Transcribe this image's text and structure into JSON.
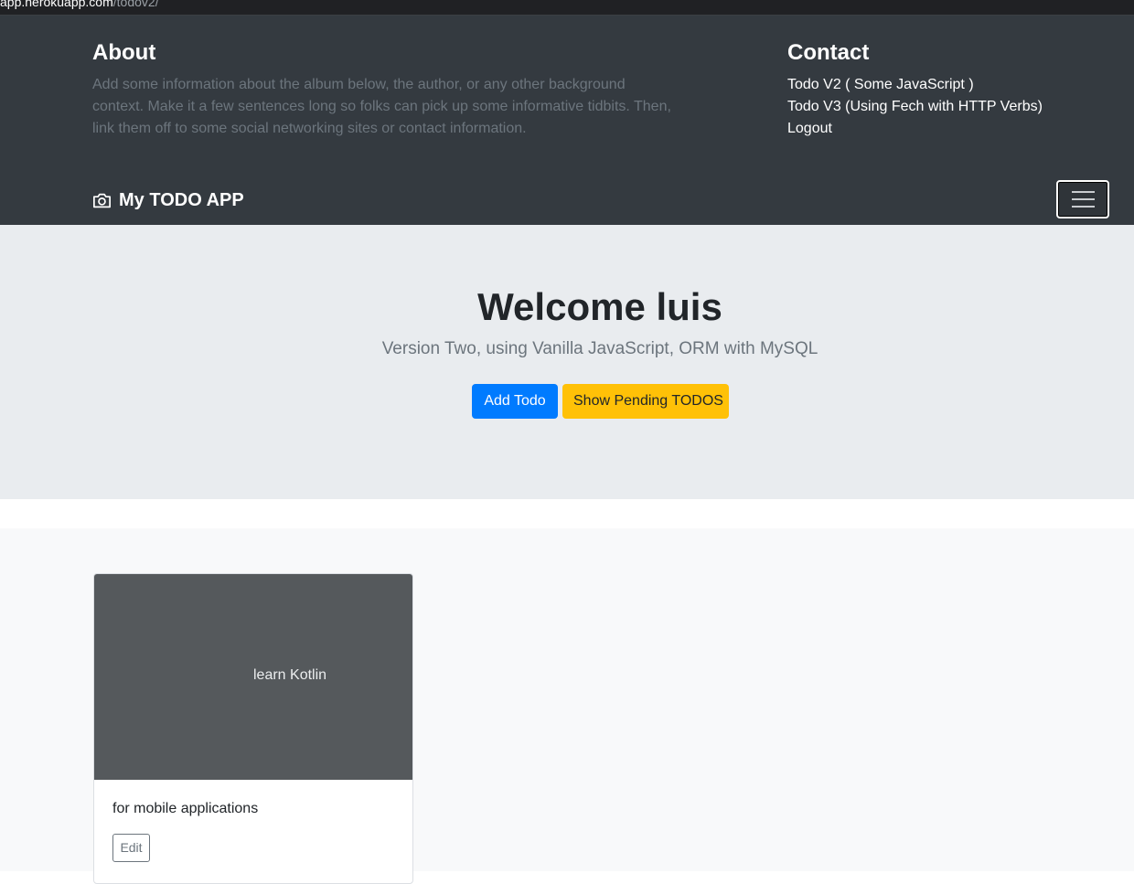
{
  "browser": {
    "url_host": "app.herokuapp.com",
    "url_path": "/todov2/"
  },
  "header": {
    "about": {
      "title": "About",
      "text": "Add some information about the album below, the author, or any other background context. Make it a few sentences long so folks can pick up some informative tidbits. Then, link them off to some social networking sites or contact information."
    },
    "contact": {
      "title": "Contact",
      "links": [
        "Todo V2 ( Some JavaScript )",
        "Todo V3 (Using Fech with HTTP Verbs)",
        "Logout"
      ]
    }
  },
  "navbar": {
    "brand": "My TODO APP",
    "brand_icon": "camera-icon",
    "toggler_icon": "hamburger-menu-icon"
  },
  "jumbotron": {
    "title": "Welcome luis",
    "lead": "Version Two, using Vanilla JavaScript, ORM with MySQL",
    "primary_button": "Add Todo",
    "secondary_button": "Show Pending TODOS"
  },
  "todos": [
    {
      "title": "learn Kotlin",
      "description": "for mobile applications",
      "edit_label": "Edit"
    }
  ],
  "colors": {
    "header_bg": "#343a40",
    "jumbotron_bg": "#e9ecef",
    "primary": "#007bff",
    "warning": "#ffc107",
    "card_image_bg": "#55595c"
  }
}
